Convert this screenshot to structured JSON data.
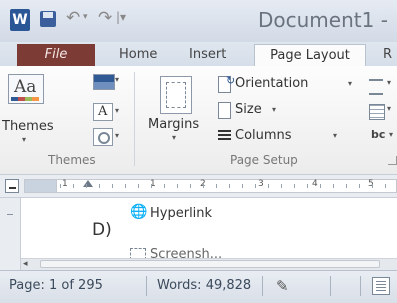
{
  "titlebar": {
    "app_icon": "W",
    "undo_icon": "undo-icon",
    "redo_icon": "redo-icon",
    "document_title": "Document1 -"
  },
  "tabs": {
    "file": "File",
    "home": "Home",
    "insert": "Insert",
    "page_layout": "Page Layout",
    "overflow": "R"
  },
  "ribbon": {
    "themes": {
      "label": "Themes",
      "group_label": "Themes",
      "glyph": "Aa",
      "fonts_glyph": "A"
    },
    "page_setup": {
      "margins_label": "Margins",
      "orientation_label": "Orientation",
      "size_label": "Size",
      "columns_label": "Columns",
      "hyphenation_glyph": "bc",
      "group_label": "Page Setup"
    }
  },
  "ruler": {
    "marks": [
      "1",
      "1",
      "2",
      "3",
      "4",
      "5"
    ]
  },
  "document": {
    "option_letter": "D)",
    "hyperlink_label": "Hyperlink",
    "screenshot_partial": "Screensh..."
  },
  "statusbar": {
    "page": "Page: 1 of 295",
    "words": "Words: 49,828"
  },
  "colors": {
    "file_tab": "#7d3b36",
    "word_brand": "#2b5797"
  }
}
